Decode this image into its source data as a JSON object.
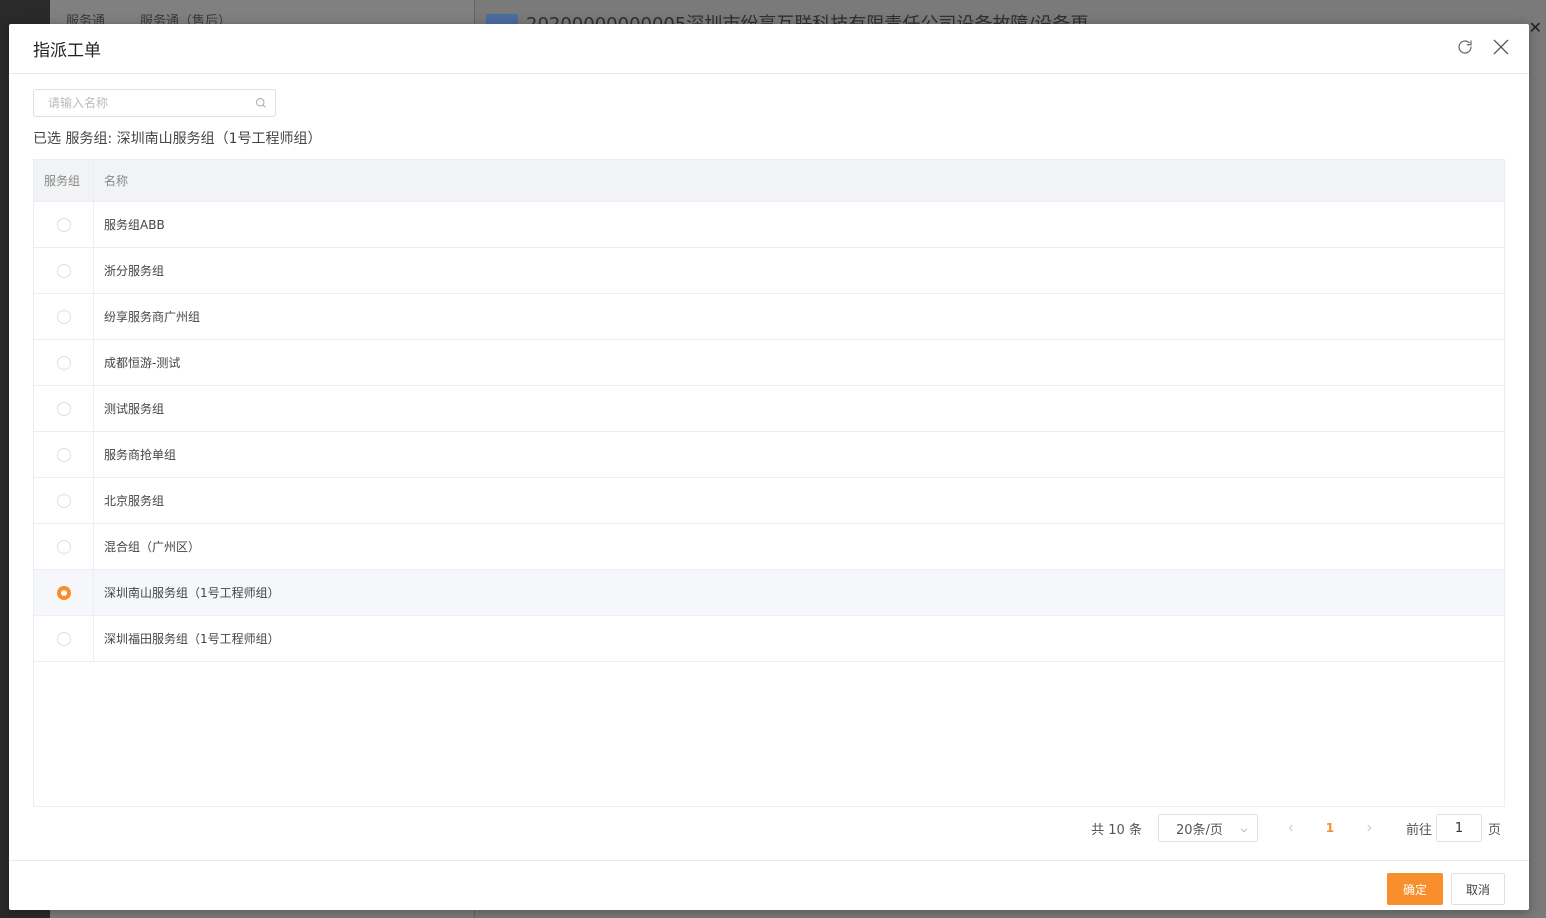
{
  "background": {
    "top_tabs": [
      "服务通",
      "服务通（售后）"
    ],
    "right_title": "20200000000005深圳市纷享互联科技有限责任公司设备故障/设备更"
  },
  "modal": {
    "title": "指派工单",
    "search_placeholder": "请输入名称",
    "selected_prefix": "已选 服务组:",
    "selected_value": "深圳南山服务组（1号工程师组）",
    "columns": [
      "服务组",
      "名称"
    ],
    "rows": [
      {
        "name": "服务组ABB",
        "checked": false
      },
      {
        "name": "浙分服务组",
        "checked": false
      },
      {
        "name": "纷享服务商广州组",
        "checked": false
      },
      {
        "name": "成都恒游-测试",
        "checked": false
      },
      {
        "name": "测试服务组",
        "checked": false
      },
      {
        "name": "服务商抢单组",
        "checked": false
      },
      {
        "name": "北京服务组",
        "checked": false
      },
      {
        "name": "混合组（广州区）",
        "checked": false
      },
      {
        "name": "深圳南山服务组（1号工程师组）",
        "checked": true
      },
      {
        "name": "深圳福田服务组（1号工程师组）",
        "checked": false
      }
    ],
    "pager": {
      "total": "共 10 条",
      "page_size": "20条/页",
      "current_page": "1",
      "goto_label": "前往",
      "goto_value": "1",
      "page_unit": "页"
    },
    "ok_label": "确定",
    "cancel_label": "取消"
  },
  "colors": {
    "accent": "#f98e2c"
  }
}
